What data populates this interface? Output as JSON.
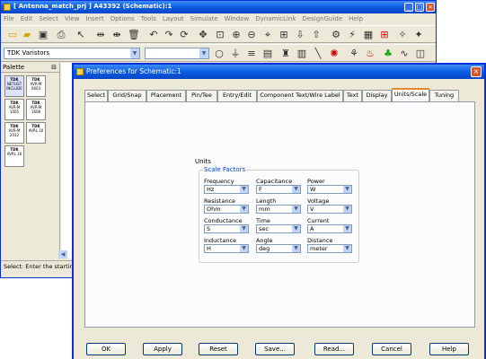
{
  "app": {
    "title": "[ Antenna_match_prj ] A43392 (Schematic):1",
    "menu": [
      "File",
      "Edit",
      "Select",
      "View",
      "Insert",
      "Options",
      "Tools",
      "Layout",
      "Simulate",
      "Window",
      "DynamicLink",
      "DesignGuide",
      "Help"
    ],
    "component_combo": "TDK Varistors",
    "palette_title": "Palette",
    "palette_items": [
      {
        "top": "TDK",
        "bottom": "NETLIST INCLUDE"
      },
      {
        "top": "TDK",
        "bottom": "AVR-M 0603"
      },
      {
        "top": "TDK",
        "bottom": "AVR-M 1005"
      },
      {
        "top": "TDK",
        "bottom": "AVR-M 1608"
      },
      {
        "top": "TDK",
        "bottom": "AVR-M 2012"
      },
      {
        "top": "TDK",
        "bottom": "AVRL 10"
      },
      {
        "top": "TDK",
        "bottom": "AVRL 16"
      }
    ],
    "status": "Select: Enter the starting point"
  },
  "dialog": {
    "title": "Preferences for Schematic:1",
    "tabs": [
      "Select",
      "Grid/Snap",
      "Placement",
      "Pin/Tee",
      "Entry/Edit",
      "Component Text/Wire Label",
      "Text",
      "Display",
      "Units/Scale",
      "Tuning"
    ],
    "active_tab": "Units/Scale",
    "units_label": "Units",
    "scale_factors_label": "Scale Factors",
    "fields": [
      {
        "label": "Frequency",
        "value": "Hz"
      },
      {
        "label": "Capacitance",
        "value": "F"
      },
      {
        "label": "Power",
        "value": "W"
      },
      {
        "label": "Resistance",
        "value": "Ohm"
      },
      {
        "label": "Length",
        "value": "mm"
      },
      {
        "label": "Voltage",
        "value": "V"
      },
      {
        "label": "Conductance",
        "value": "S"
      },
      {
        "label": "Time",
        "value": "sec"
      },
      {
        "label": "Current",
        "value": "A"
      },
      {
        "label": "Inductance",
        "value": "H"
      },
      {
        "label": "Angle",
        "value": "deg"
      },
      {
        "label": "Distance",
        "value": "meter"
      }
    ],
    "buttons": [
      "OK",
      "Apply",
      "Reset",
      "Save...",
      "Read...",
      "Cancel",
      "Help"
    ]
  },
  "colors": {
    "titlebar": "#0a5ce0",
    "accent_tab": "#e68b2c",
    "legend": "#0046d5"
  }
}
